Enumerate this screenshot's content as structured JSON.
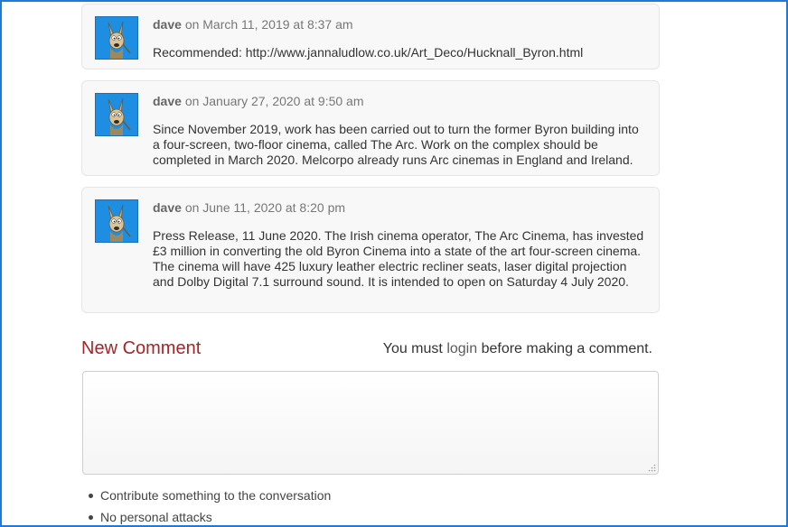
{
  "comments": [
    {
      "author": "dave",
      "date": "on March 11, 2019 at 8:37 am",
      "body": "Recommended: http://www.jannaludlow.co.uk/Art_Deco/Hucknall_Byron.html"
    },
    {
      "author": "dave",
      "date": "on January 27, 2020 at 9:50 am",
      "body": "Since November 2019, work has been carried out to turn the former Byron building into a four-screen, two-floor cinema, called The Arc. Work on the complex should be completed in March 2020. Melcorpo already runs Arc cinemas in England and Ireland."
    },
    {
      "author": "dave",
      "date": "on June 11, 2020 at 8:20 pm",
      "body": "Press Release, 11 June 2020. The Irish cinema operator, The Arc Cinema, has invested £3 million in converting the old Byron Cinema into a state of the art four-screen cinema. The cinema will have 425 luxury leather electric recliner seats, laser digital projection and Dolby Digital 7.1 surround sound. It is intended to open on Saturday 4 July 2020."
    }
  ],
  "new_comment": {
    "title": "New Comment",
    "login_prefix": "You must",
    "login_link": "login",
    "login_suffix": "before making a comment."
  },
  "rules": [
    "Contribute something to the conversation",
    "No personal attacks"
  ],
  "colors": {
    "accent_frame": "#1e7ad6",
    "title_red": "#a3262a",
    "avatar_blue": "#1e8ee2"
  },
  "icons": {
    "avatar": "coyote-avatar-icon",
    "bullet": "bullet-dot-icon",
    "resize": "resize-grip-icon"
  }
}
